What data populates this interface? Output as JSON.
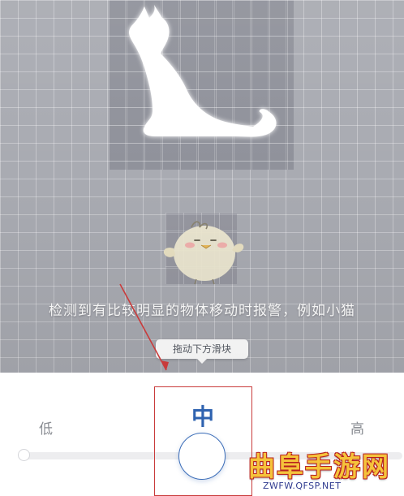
{
  "hint": {
    "detect_text": "检测到有比较明显的物体移动时报警，例如小猫",
    "drag_tip": "拖动下方滑块"
  },
  "sensitivity": {
    "low_label": "低",
    "mid_label": "中",
    "high_label": "高",
    "selected": "中",
    "levels": [
      "低",
      "中",
      "高"
    ]
  },
  "watermark": {
    "title": "曲阜手游网",
    "url": "ZWFW.QFSP.NET"
  },
  "colors": {
    "accent": "#2f63b0",
    "annotation_red": "#c93b3b",
    "preview_bg": "#a9abb2",
    "watermark_gold": "#f5c33b"
  },
  "icons": {
    "cat": "cat-silhouette-icon",
    "chick": "chick-mascot-icon",
    "arrow": "annotation-arrow-icon"
  }
}
